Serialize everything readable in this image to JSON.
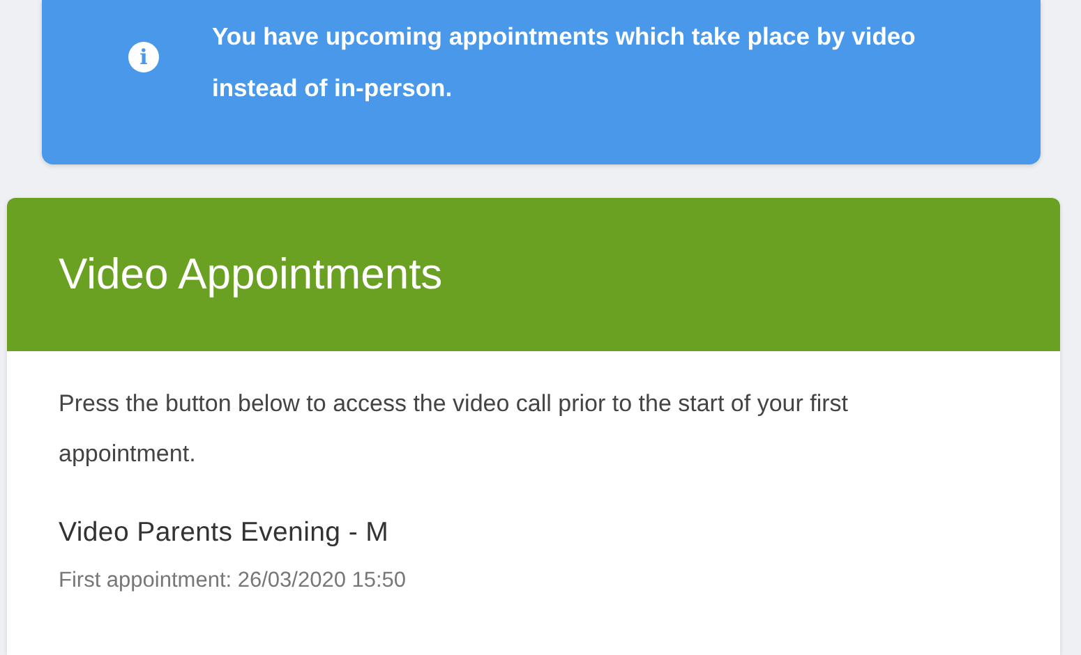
{
  "alert": {
    "icon": "i",
    "message": "You have upcoming appointments which take place by video instead of in-person."
  },
  "card": {
    "title": "Video Appointments",
    "description": "Press the button below to access the video call prior to the start of your first appointment.",
    "event": {
      "name": "Video Parents Evening - M",
      "first_appointment": "First appointment: 26/03/2020 15:50"
    }
  }
}
